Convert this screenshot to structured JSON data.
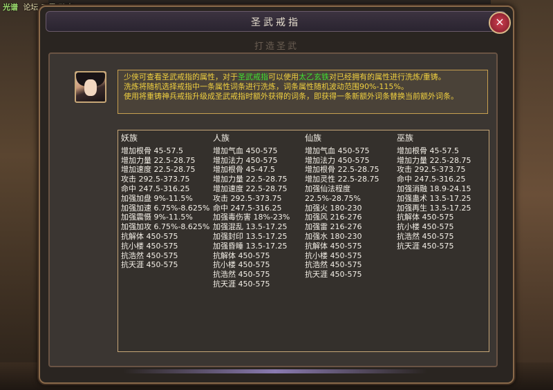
{
  "hud": {
    "logo": "光谱",
    "text": "论坛 三界 动态"
  },
  "window": {
    "title": "圣武戒指",
    "subtitle": "打造圣武",
    "close_label": "×"
  },
  "dialog": {
    "line1_pre": "少侠可查看圣武戒指的属性，对于",
    "line1_hl1": "圣武戒指",
    "line1_mid": "可以使用",
    "line1_hl2": "太乙玄铁",
    "line1_post": "对已经拥有的属性进行洗炼/重铸。",
    "line2": "洗炼将随机选择戒指中一条属性词条进行洗炼，词条属性随机波动范围90%-115%。",
    "line3": "使用将重铸神兵戒指升级成圣武戒指时额外获得的词条，即获得一条新额外词条替换当前额外词条。"
  },
  "columns": [
    {
      "header": "妖族",
      "lines": [
        "增加根骨 45-57.5",
        "增加力量 22.5-28.75",
        "增加速度 22.5-28.75",
        "攻击 292.5-373.75",
        "命中 247.5-316.25",
        "加强加盘 9%-11.5%",
        "加强加速 6.75%-8.625%",
        "加强震慑 9%-11.5%",
        "加强加攻 6.75%-8.625%",
        "抗解体 450-575",
        "抗小楼 450-575",
        "抗浩然 450-575",
        "抗天涯 450-575"
      ]
    },
    {
      "header": "人族",
      "lines": [
        "增加气血 450-575",
        "增加法力 450-575",
        "增加根骨 45-47.5",
        "增加力量 22.5-28.75",
        "增加速度 22.5-28.75",
        "攻击 292.5-373.75",
        "命中 247.5-316.25",
        "加强毒伤害 18%-23%",
        "加强混乱 13.5-17.25",
        "加强封印 13.5-17.25",
        "加强昏睡 13.5-17.25",
        "抗解体 450-575",
        "抗小楼 450-575",
        "抗浩然 450-575",
        "抗天涯 450-575"
      ]
    },
    {
      "header": "仙族",
      "lines": [
        "增加气血 450-575",
        "增加法力 450-575",
        "增加根骨 22.5-28.75",
        "增加灵性 22.5-28.75",
        "加强仙法程度 22.5%-28.75%",
        "加强火 180-230",
        "加强风 216-276",
        "加强雷 216-276",
        "加强水 180-230",
        "抗解体 450-575",
        "抗小楼 450-575",
        "抗浩然 450-575",
        "抗天涯 450-575"
      ]
    },
    {
      "header": "巫族",
      "lines": [
        "增加根骨 45-57.5",
        "增加力量 22.5-28.75",
        "攻击 292.5-373.75",
        "命中 247.5-316.25",
        "加强消融 18.9-24.15",
        "加强蛊术 13.5-17.25",
        "加强再生 13.5-17.25",
        "抗解体 450-575",
        "抗小楼 450-575",
        "抗浩然 450-575",
        "抗天涯 450-575"
      ]
    }
  ]
}
